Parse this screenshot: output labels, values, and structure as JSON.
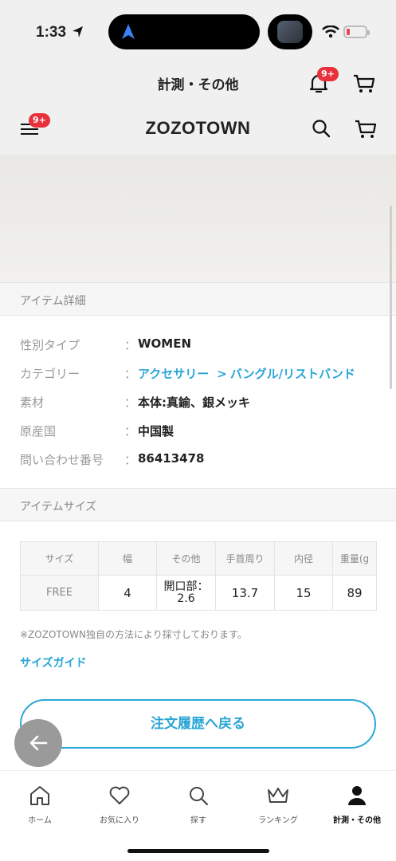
{
  "status": {
    "time": "1:33"
  },
  "header": {
    "title": "計測・その他",
    "notification_badge": "9+"
  },
  "brand": {
    "logo": "ZOZOTOWN",
    "menu_badge": "9+"
  },
  "item_details": {
    "heading": "アイテム詳細",
    "rows": [
      {
        "label": "性別タイプ",
        "colon": "：",
        "value": "WOMEN"
      },
      {
        "label": "カテゴリー",
        "colon": "：",
        "link1": "アクセサリー",
        "separator": ">",
        "link2": "バングル/リストバンド"
      },
      {
        "label": "素材",
        "colon": "：",
        "value": "本体:真鍮、銀メッキ"
      },
      {
        "label": "原産国",
        "colon": "：",
        "value": "中国製"
      },
      {
        "label": "問い合わせ番号",
        "colon": "：",
        "value": "86413478"
      }
    ]
  },
  "item_size": {
    "heading": "アイテムサイズ",
    "headers": [
      "サイズ",
      "幅",
      "その他",
      "手首周り",
      "内径",
      "重量(g"
    ],
    "row": [
      "FREE",
      "4",
      "開口部：2.6",
      "13.7",
      "15",
      "89"
    ],
    "note": "※ZOZOTOWN独自の方法により採寸しております。",
    "size_guide": "サイズガイド"
  },
  "actions": {
    "back_to_orders": "注文履歴へ戻る"
  },
  "tabbar": {
    "items": [
      {
        "label": "ホーム",
        "icon": "home-icon"
      },
      {
        "label": "お気に入り",
        "icon": "heart-icon"
      },
      {
        "label": "探す",
        "icon": "search-icon"
      },
      {
        "label": "ランキング",
        "icon": "crown-icon"
      },
      {
        "label": "計測・その他",
        "icon": "person-icon",
        "active": true
      }
    ]
  }
}
